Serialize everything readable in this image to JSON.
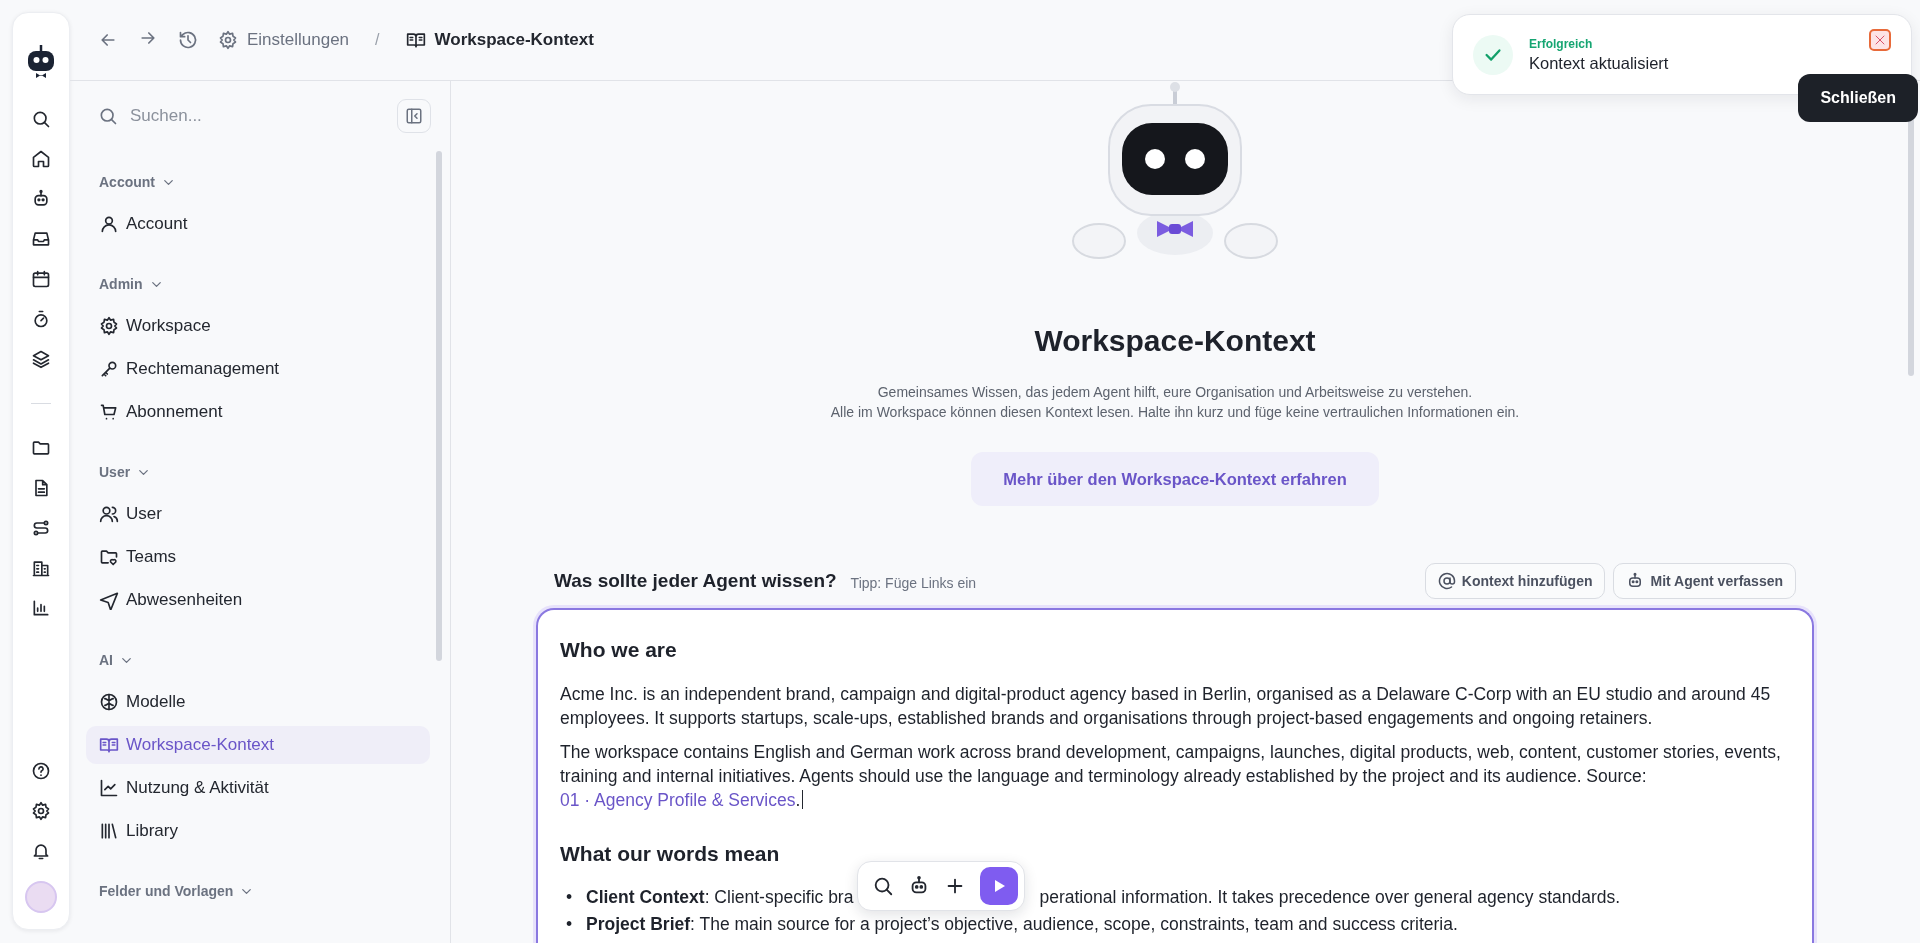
{
  "breadcrumb": {
    "parent": "Einstellungen",
    "separator": "/",
    "current": "Workspace-Kontext"
  },
  "sidebar": {
    "search": {
      "placeholder": "Suchen..."
    },
    "groups": [
      {
        "title": "Account",
        "expanded": true,
        "items": [
          {
            "label": "Account",
            "selected": false
          }
        ]
      },
      {
        "title": "Admin",
        "expanded": true,
        "items": [
          {
            "label": "Workspace",
            "selected": false
          },
          {
            "label": "Rechtemanagement",
            "selected": false
          },
          {
            "label": "Abonnement",
            "selected": false
          }
        ]
      },
      {
        "title": "User",
        "expanded": true,
        "items": [
          {
            "label": "User",
            "selected": false
          },
          {
            "label": "Teams",
            "selected": false
          },
          {
            "label": "Abwesenheiten",
            "selected": false
          }
        ]
      },
      {
        "title": "AI",
        "expanded": true,
        "items": [
          {
            "label": "Modelle",
            "selected": false
          },
          {
            "label": "Workspace-Kontext",
            "selected": true
          },
          {
            "label": "Nutzung & Aktivität",
            "selected": false
          },
          {
            "label": "Library",
            "selected": false
          }
        ]
      },
      {
        "title": "Felder und Vorlagen",
        "expanded": true
      }
    ]
  },
  "page": {
    "title": "Workspace-Kontext",
    "description": [
      "Gemeinsames Wissen, das jedem Agent hilft, eure Organisation und Arbeitsweise zu verstehen.",
      "Alle im Workspace können diesen Kontext lesen. Halte ihn kurz und füge keine vertraulichen Informationen ein."
    ],
    "learn_more": "Mehr über den Workspace-Kontext erfahren"
  },
  "editor": {
    "heading": "Was sollte jeder Agent wissen?",
    "tip": "Tipp: Füge Links ein",
    "actions": [
      "Kontext hinzufügen",
      "Mit Agent verfassen"
    ],
    "focused": true,
    "blocks": [
      {
        "kind": "heading",
        "text": "Who we are"
      },
      {
        "kind": "paragraph",
        "text": "Acme Inc. is an independent brand, campaign and digital-product agency based in Berlin, organised as a Delaware C-Corp with an EU studio and around 45 employees. It supports startups, scale-ups, established brands and organisations through project-based engagements and ongoing retainers."
      },
      {
        "kind": "paragraph",
        "text": "The workspace contains English and German work across brand development, campaigns, launches, digital products, web, content, customer stories, events, training and internal initiatives. Agents should use the language and terminology already established by the project and its audience. Source: ",
        "link": "01 · Agency Profile & Services",
        "after": "."
      },
      {
        "kind": "heading",
        "text": "What our words mean"
      },
      {
        "kind": "bullets",
        "items": [
          {
            "marker": "•",
            "parts": [
              "**Client Context**: Client-specific bra",
              "perational information. It takes precedence over general agency standards."
            ]
          },
          {
            "marker": "•",
            "parts": [
              "**Project Brief**: The main source for a project’s objective, audience, scope, constraints, team and success criteria."
            ]
          }
        ]
      }
    ]
  },
  "toast": {
    "status": "Erfolgreich",
    "message": "Kontext aktualisiert",
    "tooltip": "Schließen"
  }
}
